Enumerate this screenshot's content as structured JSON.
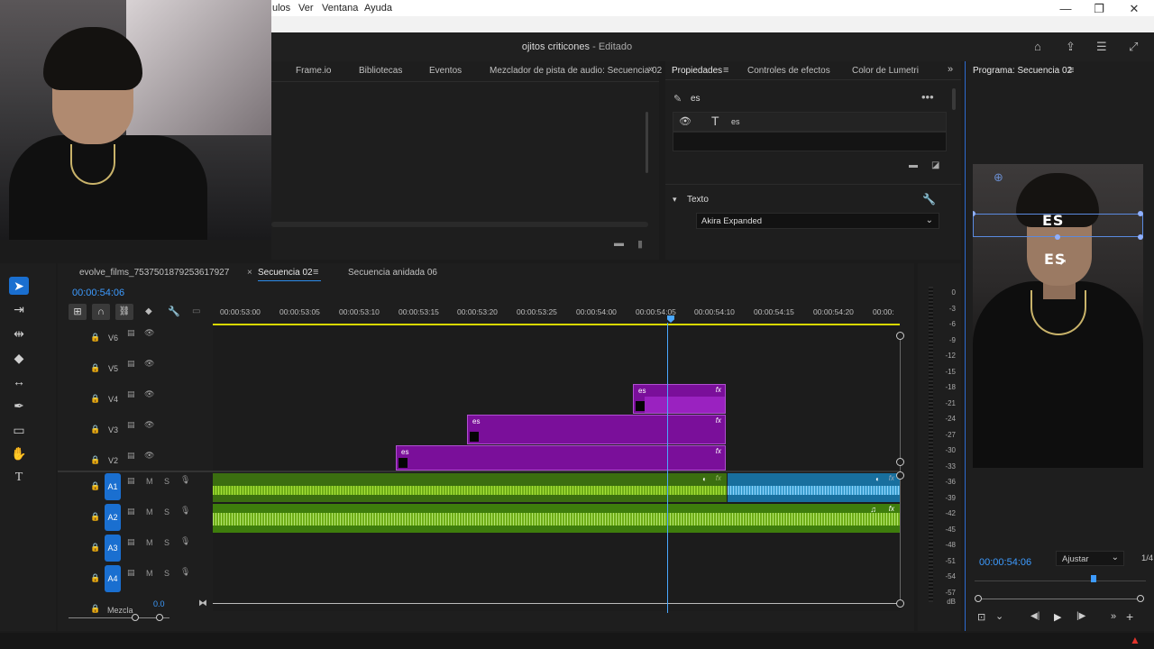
{
  "menu": {
    "items": [
      "ulos",
      "Ver",
      "Ventana",
      "Ayuda"
    ]
  },
  "window": {
    "minimize": "—",
    "restore": "❐",
    "close": "✕"
  },
  "titlebar": {
    "title": "ojitos criticones",
    "status": " - Editado"
  },
  "source_panel": {
    "tabs": [
      "Frame.io",
      "Bibliotecas",
      "Eventos",
      "Mezclador de pista de audio: Secuencia 02"
    ]
  },
  "properties": {
    "tabs": [
      "Propiedades",
      "Controles de efectos",
      "Color de Lumetri"
    ],
    "layer_name": "es",
    "text_layer": "es",
    "section": "Texto",
    "font": "Akira Expanded"
  },
  "program": {
    "title": "Programa: Secuencia 02",
    "overlay_top": "ES",
    "overlay_bottom": "ES",
    "timecode": "00:00:54:06",
    "fit": "Ajustar",
    "resolution": "1/4"
  },
  "timeline": {
    "tabs": [
      "evolve_films_7537501879253617927",
      "Secuencia 02",
      "Secuencia anidada 06"
    ],
    "timecode": "00:00:54:06",
    "ruler": [
      "00:00:53:00",
      "00:00:53:05",
      "00:00:53:10",
      "00:00:53:15",
      "00:00:53:20",
      "00:00:53:25",
      "00:00:54:00",
      "00:00:54:05",
      "00:00:54:10",
      "00:00:54:15",
      "00:00:54:20",
      "00:00:"
    ],
    "video_tracks": [
      "V6",
      "V5",
      "V4",
      "V3",
      "V2"
    ],
    "audio_tracks": [
      "A1",
      "A2",
      "A3",
      "A4"
    ],
    "mute": "M",
    "solo": "S",
    "mix_label": "Mezcla",
    "mix_value": "0.0",
    "clip_label": "es",
    "fx": "fx"
  },
  "vu_meter": {
    "labels": [
      "0",
      "-3",
      "-6",
      "-9",
      "-12",
      "-15",
      "-18",
      "-21",
      "-24",
      "-27",
      "-30",
      "-33",
      "-36",
      "-39",
      "-42",
      "-45",
      "-48",
      "-51",
      "-54",
      "-57",
      "dB"
    ]
  },
  "colors": {
    "accent": "#2d8ceb",
    "clip_purple": "#7a0f9a",
    "audio_green": "#3e7d0c",
    "audio_blue": "#1c7fb5",
    "playhead": "#4aa8ff"
  }
}
